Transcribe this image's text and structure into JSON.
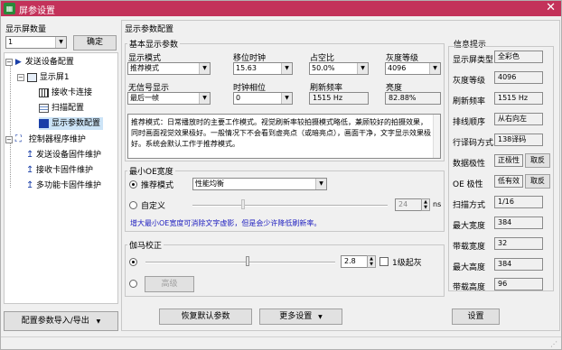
{
  "window": {
    "title": "屏参设置",
    "close": "✕"
  },
  "left": {
    "count_label": "显示屏数量",
    "count_value": "1",
    "confirm": "确定",
    "tree": [
      {
        "label": "发送设备配置"
      },
      {
        "label": "显示屏1"
      },
      {
        "label": "接收卡连接"
      },
      {
        "label": "扫描配置"
      },
      {
        "label": "显示参数配置"
      },
      {
        "label": "控制器程序维护"
      },
      {
        "label": "发送设备固件维护"
      },
      {
        "label": "接收卡固件维护"
      },
      {
        "label": "多功能卡固件维护"
      }
    ],
    "import_export": "配置参数导入/导出"
  },
  "main": {
    "header": "显示参数配置",
    "basic": {
      "title": "基本显示参数",
      "fields": [
        {
          "label": "显示模式",
          "value": "推荐模式"
        },
        {
          "label": "移位时钟",
          "value": "15.63"
        },
        {
          "label": "占空比",
          "value": "50.0%"
        },
        {
          "label": "灰度等级",
          "value": "4096"
        },
        {
          "label": "无信号显示",
          "value": "最后一帧"
        },
        {
          "label": "时钟相位",
          "value": "0"
        },
        {
          "label": "刷新频率",
          "value": "1515 Hz"
        },
        {
          "label": "亮度",
          "value": "82.88%"
        }
      ],
      "description": "推荐模式：日常播放时的主要工作模式。视觉刷新率较拍摄模式略低，兼顾较好的拍摄效果，同时画面视觉效果极好。一般情况下不会看到虚亮点（或暗亮点），画面干净，文字显示效果极好。系统会默认工作于推荐模式。"
    },
    "min_oe": {
      "title": "最小OE宽度",
      "recommend_label": "推荐模式",
      "recommend_value": "性能均衡",
      "custom_label": "自定义",
      "custom_value": "24",
      "unit": "ns",
      "note": "增大最小OE宽度可消除文字虚影，但是会少许降低刷新率。"
    },
    "gamma": {
      "title": "伽马校正",
      "value": "2.8",
      "checkbox_label": "1级起灰",
      "advanced": "高级"
    },
    "buttons": {
      "restore": "恢复默认参数",
      "more": "更多设置",
      "set": "设置"
    }
  },
  "info": {
    "title": "信息提示",
    "items": [
      {
        "label": "显示屏类型",
        "value": "全彩色"
      },
      {
        "label": "灰度等级",
        "value": "4096"
      },
      {
        "label": "刷新频率",
        "value": "1515 Hz"
      },
      {
        "label": "排线顺序",
        "value": "从右向左"
      },
      {
        "label": "行译码方式",
        "value": "138译码"
      },
      {
        "label": "数据极性",
        "value": "正极性",
        "action": "取反"
      },
      {
        "label": "OE 极性",
        "value": "低有效",
        "action": "取反"
      },
      {
        "label": "扫描方式",
        "value": "1/16"
      },
      {
        "label": "最大宽度",
        "value": "384"
      },
      {
        "label": "带载宽度",
        "value": "32"
      },
      {
        "label": "最大高度",
        "value": "384"
      },
      {
        "label": "带载高度",
        "value": "96"
      }
    ]
  },
  "colors": {
    "titlebar": "#c3325a",
    "link_note": "#2020c0",
    "selected": "#cce4f7"
  }
}
